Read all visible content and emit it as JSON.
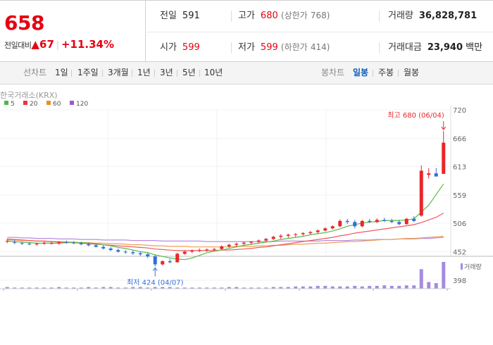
{
  "quote": {
    "price": "658",
    "change_label": "전일대비",
    "change_value": "▲67",
    "change_pct": "+11.34%",
    "prev_close_label": "전일",
    "prev_close": "591",
    "high_label": "고가",
    "high": "680",
    "upper_limit_label": "(상한가",
    "upper_limit": "768)",
    "volume_label": "거래량",
    "volume": "36,828,781",
    "open_label": "시가",
    "open": "599",
    "low_label": "저가",
    "low": "599",
    "lower_limit_label": "(하한가",
    "lower_limit": "414)",
    "value_label": "거래대금",
    "value": "23,940",
    "value_unit": "백만"
  },
  "tabs": {
    "line_header": "선차트",
    "line_items": [
      "1일",
      "1주일",
      "3개월",
      "1년",
      "3년",
      "5년",
      "10년"
    ],
    "candle_header": "봉차트",
    "candle_items": [
      "일봉",
      "주봉",
      "월봉"
    ],
    "active": "일봉"
  },
  "chart_data": {
    "type": "candlestick",
    "exchange": "한국거래소(KRX)",
    "legend": [
      {
        "name": "5",
        "color": "#4db848"
      },
      {
        "name": "20",
        "color": "#e8383d"
      },
      {
        "name": "60",
        "color": "#f08c28"
      },
      {
        "name": "120",
        "color": "#9b59d0"
      }
    ],
    "y_ticks": [
      "720",
      "666",
      "613",
      "559",
      "506",
      "452",
      "398"
    ],
    "ylim": [
      398,
      720
    ],
    "high_annotation": "최고 680 (06/04)",
    "low_annotation": "최저 424 (04/07)",
    "volume_label": "거래량",
    "candles": [
      [
        472,
        476,
        468,
        472
      ],
      [
        470,
        474,
        466,
        469
      ],
      [
        468,
        471,
        465,
        467
      ],
      [
        467,
        470,
        464,
        466
      ],
      [
        466,
        469,
        463,
        467
      ],
      [
        467,
        471,
        465,
        469
      ],
      [
        468,
        472,
        466,
        468
      ],
      [
        468,
        471,
        465,
        470
      ],
      [
        470,
        473,
        467,
        469
      ],
      [
        469,
        472,
        466,
        468
      ],
      [
        468,
        471,
        464,
        466
      ],
      [
        466,
        469,
        462,
        464
      ],
      [
        464,
        467,
        460,
        461
      ],
      [
        461,
        464,
        456,
        458
      ],
      [
        458,
        461,
        453,
        455
      ],
      [
        455,
        458,
        450,
        452
      ],
      [
        452,
        455,
        448,
        451
      ],
      [
        451,
        454,
        446,
        449
      ],
      [
        449,
        452,
        444,
        447
      ],
      [
        447,
        450,
        440,
        443
      ],
      [
        443,
        446,
        424,
        428
      ],
      [
        428,
        436,
        426,
        434
      ],
      [
        434,
        438,
        430,
        432
      ],
      [
        432,
        450,
        431,
        448
      ],
      [
        448,
        454,
        446,
        452
      ],
      [
        452,
        456,
        449,
        454
      ],
      [
        454,
        458,
        451,
        455
      ],
      [
        455,
        458,
        452,
        456
      ],
      [
        456,
        459,
        453,
        457
      ],
      [
        457,
        464,
        455,
        462
      ],
      [
        462,
        467,
        459,
        465
      ],
      [
        465,
        469,
        461,
        467
      ],
      [
        467,
        471,
        464,
        469
      ],
      [
        469,
        472,
        465,
        471
      ],
      [
        471,
        475,
        468,
        473
      ],
      [
        473,
        478,
        470,
        476
      ],
      [
        476,
        482,
        474,
        480
      ],
      [
        480,
        485,
        476,
        482
      ],
      [
        482,
        486,
        478,
        484
      ],
      [
        484,
        487,
        480,
        485
      ],
      [
        485,
        489,
        482,
        487
      ],
      [
        487,
        491,
        484,
        489
      ],
      [
        489,
        494,
        486,
        492
      ],
      [
        492,
        498,
        490,
        496
      ],
      [
        496,
        502,
        494,
        500
      ],
      [
        500,
        513,
        498,
        510
      ],
      [
        510,
        514,
        504,
        508
      ],
      [
        508,
        512,
        496,
        500
      ],
      [
        500,
        512,
        498,
        510
      ],
      [
        510,
        514,
        506,
        508
      ],
      [
        508,
        515,
        506,
        512
      ],
      [
        512,
        516,
        508,
        510
      ],
      [
        510,
        514,
        506,
        508
      ],
      [
        508,
        512,
        502,
        504
      ],
      [
        504,
        516,
        503,
        514
      ],
      [
        514,
        519,
        508,
        510
      ],
      [
        520,
        615,
        518,
        605
      ],
      [
        597,
        610,
        590,
        600
      ],
      [
        600,
        610,
        596,
        594
      ],
      [
        599,
        680,
        599,
        658
      ]
    ],
    "ma5": [
      472,
      471,
      470,
      469,
      468,
      468,
      468,
      468,
      469,
      469,
      469,
      468,
      467,
      465,
      463,
      460,
      458,
      455,
      452,
      450,
      446,
      443,
      440,
      438,
      437,
      440,
      445,
      450,
      453,
      455,
      458,
      461,
      464,
      466,
      468,
      470,
      472,
      475,
      477,
      479,
      481,
      484,
      486,
      488,
      491,
      495,
      500,
      503,
      506,
      508,
      509,
      511,
      511,
      511,
      512,
      514,
      527,
      540,
      560,
      580
    ],
    "ma20": [
      476,
      475,
      474,
      473,
      472,
      472,
      471,
      470,
      470,
      469,
      468,
      467,
      466,
      465,
      464,
      463,
      462,
      461,
      460,
      459,
      457,
      456,
      455,
      454,
      454,
      454,
      454,
      454,
      454,
      455,
      455,
      456,
      457,
      458,
      460,
      461,
      463,
      465,
      467,
      469,
      471,
      473,
      475,
      477,
      479,
      482,
      484,
      487,
      489,
      491,
      493,
      495,
      497,
      499,
      501,
      503,
      507,
      512,
      517,
      525
    ],
    "ma60": [
      474,
      474,
      473,
      473,
      472,
      472,
      471,
      471,
      470,
      470,
      469,
      469,
      468,
      468,
      467,
      467,
      466,
      465,
      465,
      464,
      463,
      463,
      462,
      462,
      462,
      461,
      461,
      461,
      461,
      461,
      461,
      462,
      462,
      462,
      463,
      463,
      464,
      464,
      465,
      466,
      466,
      467,
      468,
      468,
      469,
      470,
      471,
      471,
      472,
      473,
      474,
      475,
      475,
      476,
      477,
      477,
      478,
      479,
      480,
      481
    ],
    "ma120": [
      479,
      479,
      478,
      478,
      477,
      477,
      477,
      476,
      476,
      476,
      475,
      475,
      475,
      474,
      474,
      474,
      474,
      473,
      473,
      473,
      473,
      472,
      472,
      472,
      472,
      472,
      472,
      471,
      471,
      471,
      471,
      471,
      471,
      471,
      471,
      471,
      471,
      472,
      472,
      472,
      472,
      472,
      472,
      473,
      473,
      473,
      473,
      474,
      474,
      474,
      475,
      475,
      475,
      476,
      476,
      476,
      477,
      477,
      478,
      479
    ],
    "volume": [
      3,
      2,
      2,
      2,
      2,
      2,
      2,
      3,
      2,
      2,
      2,
      3,
      2,
      3,
      3,
      2,
      2,
      3,
      3,
      2,
      3,
      3,
      3,
      2,
      2,
      2,
      2,
      2,
      2,
      2,
      3,
      3,
      2,
      2,
      2,
      2,
      3,
      3,
      3,
      4,
      4,
      4,
      5,
      5,
      4,
      4,
      4,
      5,
      4,
      5,
      5,
      6,
      5,
      5,
      6,
      6,
      35,
      12,
      10,
      48
    ]
  }
}
